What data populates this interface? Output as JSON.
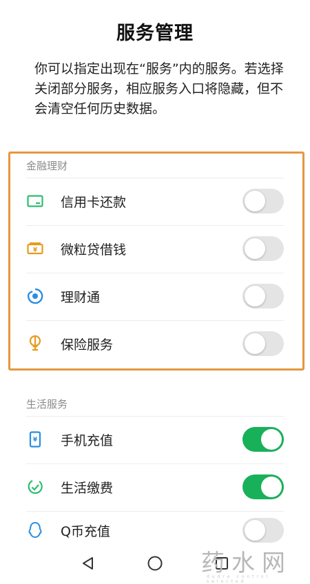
{
  "header": {
    "title": "服务管理",
    "description": "你可以指定出现在“服务”内的服务。若选择关闭部分服务，相应服务入口将隐藏，但不会清空任何历史数据。"
  },
  "sections": [
    {
      "label": "金融理财",
      "items": [
        {
          "label": "信用卡还款",
          "icon": "credit-card-icon",
          "enabled": false
        },
        {
          "label": "微粒贷借钱",
          "icon": "loan-wallet-icon",
          "enabled": false
        },
        {
          "label": "理财通",
          "icon": "wealth-icon",
          "enabled": false
        },
        {
          "label": "保险服务",
          "icon": "insurance-icon",
          "enabled": false
        }
      ]
    },
    {
      "label": "生活服务",
      "items": [
        {
          "label": "手机充值",
          "icon": "mobile-topup-icon",
          "enabled": true
        },
        {
          "label": "生活缴费",
          "icon": "bill-payment-icon",
          "enabled": true
        },
        {
          "label": "Q币充值",
          "icon": "qq-coin-icon",
          "enabled": false
        }
      ]
    }
  ],
  "navbar": {
    "back": "back-icon",
    "home": "home-icon",
    "recents": "recents-icon"
  },
  "watermark": {
    "text": "药水网",
    "sub": "dudre control selected"
  },
  "colors": {
    "toggle_on": "#19b05a",
    "toggle_off": "#e4e4e4",
    "highlight_border": "#e6963f",
    "green_icon": "#2dbd6e",
    "orange_icon": "#e59b1e",
    "blue_icon": "#2a8ee0"
  }
}
